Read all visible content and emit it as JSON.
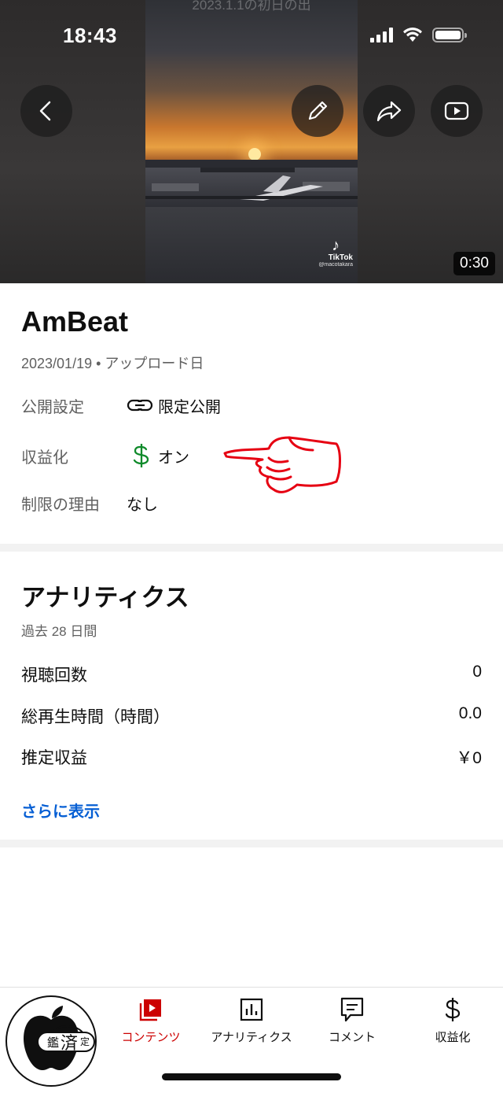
{
  "status_bar": {
    "time": "18:43"
  },
  "video": {
    "overlay_text": "2023.1.1の初日の出",
    "watermark": {
      "brand": "TikTok",
      "user": "@macotakara"
    },
    "duration": "0:30"
  },
  "details": {
    "title": "AmBeat",
    "upload_date": "2023/01/19",
    "upload_suffix": "アップロード日",
    "visibility": {
      "label": "公開設定",
      "value": "限定公開",
      "icon": "link-icon"
    },
    "monetization": {
      "label": "収益化",
      "value": "オン",
      "icon": "dollar-icon",
      "icon_color": "#0f8a2a"
    },
    "restriction": {
      "label": "制限の理由",
      "value": "なし"
    }
  },
  "analytics": {
    "title": "アナリティクス",
    "period": "過去 28 日間",
    "metrics": [
      {
        "label": "視聴回数",
        "value": "0"
      },
      {
        "label": "総再生時間（時間）",
        "value": "0.0"
      },
      {
        "label": "推定収益",
        "value": "￥0"
      }
    ],
    "show_more": "さらに表示"
  },
  "bottom_nav": {
    "items": [
      {
        "label": "",
        "icon": "dashboard-icon"
      },
      {
        "label": "コンテンツ",
        "icon": "content-icon",
        "active": true
      },
      {
        "label": "アナリティクス",
        "icon": "analytics-icon"
      },
      {
        "label": "コメント",
        "icon": "comment-icon"
      },
      {
        "label": "収益化",
        "icon": "dollar-icon"
      }
    ]
  },
  "stamp": {
    "text_left": "鑑",
    "text_center": "済",
    "text_right": "定"
  },
  "colors": {
    "accent": "#cc0000",
    "link": "#065fd4",
    "money": "#0f8a2a",
    "annotation": "#e60012"
  }
}
